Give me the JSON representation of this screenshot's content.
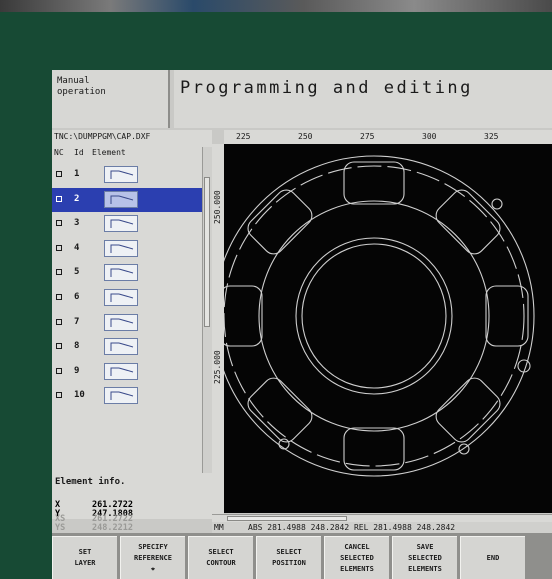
{
  "header": {
    "mode_label": "Manual\noperation",
    "title": "Programming and editing"
  },
  "file": {
    "path": "TNC:\\DUMPPGM\\CAP.DXF"
  },
  "list": {
    "columns": [
      "NC",
      "Id",
      "Element"
    ],
    "rows": [
      {
        "id": "1",
        "selected": false
      },
      {
        "id": "2",
        "selected": true
      },
      {
        "id": "3",
        "selected": false
      },
      {
        "id": "4",
        "selected": false
      },
      {
        "id": "5",
        "selected": false
      },
      {
        "id": "6",
        "selected": false
      },
      {
        "id": "7",
        "selected": false
      },
      {
        "id": "8",
        "selected": false
      },
      {
        "id": "9",
        "selected": false
      },
      {
        "id": "10",
        "selected": false
      }
    ]
  },
  "element_info": {
    "title": "Element info.",
    "x_label": "X",
    "x_value": "261.2722",
    "y_label": "Y",
    "y_value": "247.1808",
    "xs_label": "XS",
    "xs_value": "261.2722",
    "ys_label": "YS",
    "ys_value": "248.2212"
  },
  "ruler": {
    "top_ticks": [
      "225",
      "250",
      "275",
      "300",
      "325"
    ],
    "left_ticks": [
      "250.000",
      "225.000"
    ]
  },
  "status": {
    "unit": "MM",
    "coords": "ABS 281.4988 248.2842 REL 281.4988 248.2842"
  },
  "softkeys": [
    "SET\nLAYER",
    "SPECIFY\nREFERENCE\n⌖",
    "SELECT\nCONTOUR",
    "SELECT\nPOSITION",
    "CANCEL\nSELECTED\nELEMENTS",
    "SAVE\nSELECTED\nELEMENTS",
    "END"
  ]
}
